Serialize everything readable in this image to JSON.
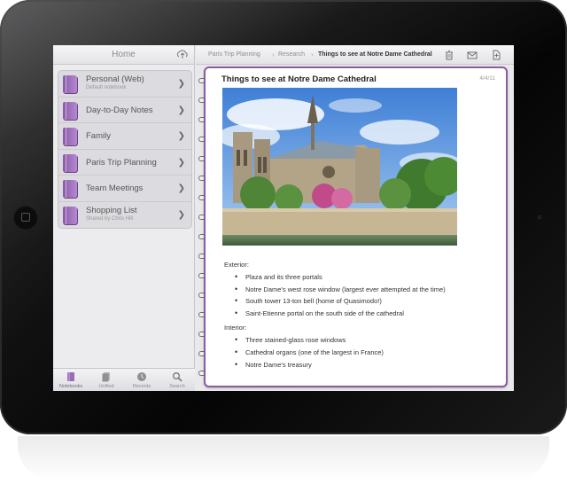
{
  "sidebar": {
    "title": "Home",
    "notebooks": [
      {
        "label": "Personal (Web)",
        "sub": "Default notebook"
      },
      {
        "label": "Day-to-Day Notes",
        "sub": ""
      },
      {
        "label": "Family",
        "sub": ""
      },
      {
        "label": "Paris Trip Planning",
        "sub": ""
      },
      {
        "label": "Team Meetings",
        "sub": ""
      },
      {
        "label": "Shopping List",
        "sub": "Shared by Chris Hill"
      }
    ],
    "tabs": [
      {
        "label": "Notebooks"
      },
      {
        "label": "Unfiled"
      },
      {
        "label": "Recents"
      },
      {
        "label": "Search"
      }
    ]
  },
  "breadcrumb": {
    "notebook": "Paris Trip Planning",
    "section": "Research",
    "page": "Things to see at Notre Dame Cathedral"
  },
  "page": {
    "title": "Things to see at Notre Dame Cathedral",
    "date": "4/4/11",
    "sections": [
      {
        "heading": "Exterior:",
        "items": [
          "Plaza and its three portals",
          "Notre Dame's west rose window (largest ever attempted at the time)",
          "South tower 13-ton bell (home of Quasimodo!)",
          "Saint-Etienne portal on the south side of the cathedral"
        ]
      },
      {
        "heading": "Interior:",
        "items": [
          "Three stained-glass rose windows",
          "Cathedral organs (one of the largest in France)",
          "Notre Dame's treasury"
        ]
      }
    ]
  },
  "colors": {
    "accent": "#8a5ca2",
    "notebook": "#a274c0"
  }
}
